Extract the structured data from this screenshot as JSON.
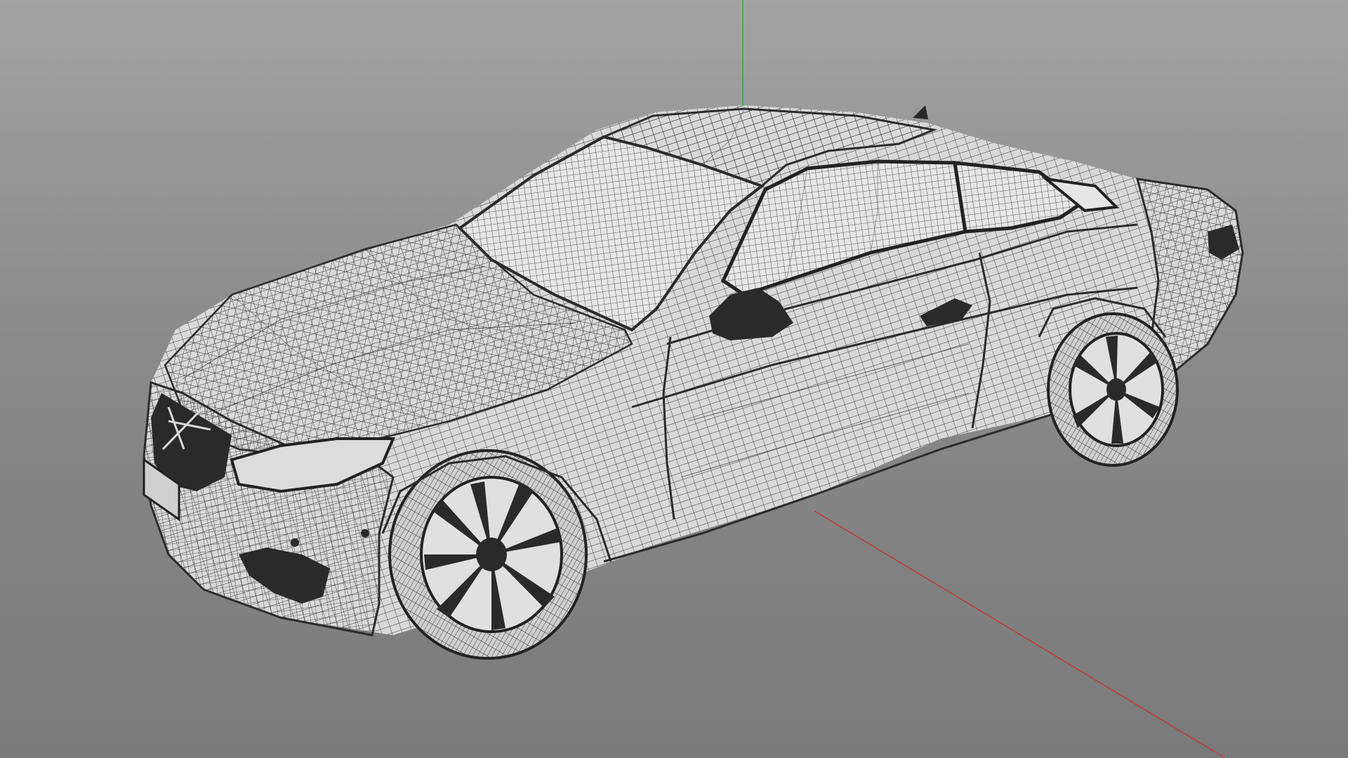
{
  "viewport": {
    "mode": "wireframe",
    "background_top": "#a3a3a3",
    "background_bottom": "#7a7a7a",
    "axis_colors": {
      "x": "#c0393b",
      "y": "#2fae3a"
    }
  },
  "model": {
    "subject": "car-icon",
    "style": "quad mesh wireframe",
    "mesh_color": "#2b2b2b",
    "surface_color": "#d9d9d9"
  }
}
